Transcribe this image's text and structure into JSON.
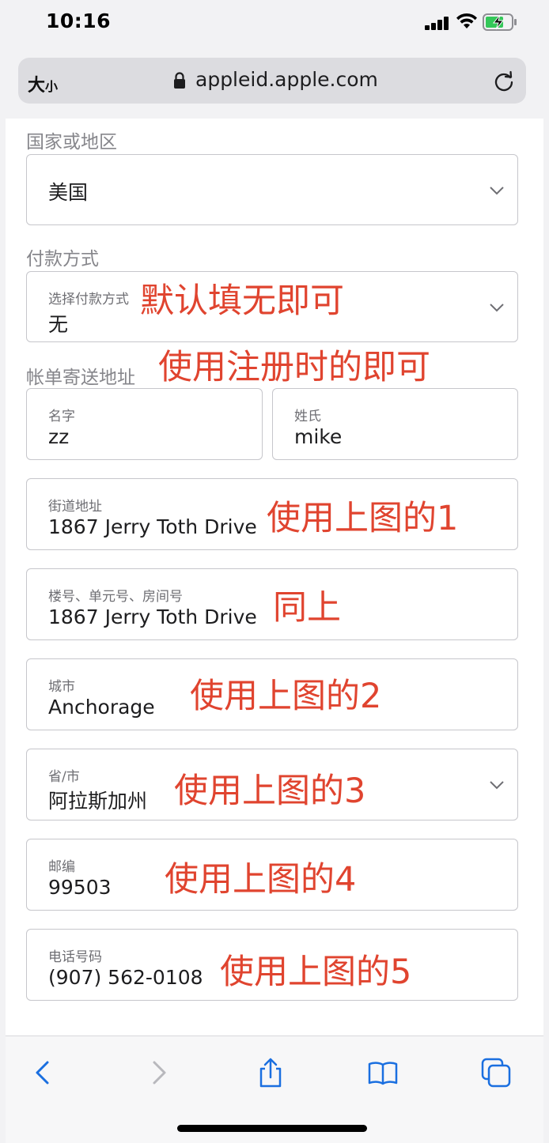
{
  "status": {
    "time": "10:16"
  },
  "browser": {
    "text_size_label": "大",
    "text_size_small": "小",
    "url": "appleid.apple.com"
  },
  "sections": {
    "country": "国家或地区",
    "payment": "付款方式",
    "billing": "帐单寄送地址"
  },
  "fields": {
    "country": {
      "value": "美国"
    },
    "payment": {
      "label": "选择付款方式",
      "value": "无"
    },
    "first_name": {
      "label": "名字",
      "value": "zz"
    },
    "last_name": {
      "label": "姓氏",
      "value": "mike"
    },
    "street": {
      "label": "街道地址",
      "value": "1867  Jerry Toth Drive"
    },
    "building": {
      "label": "楼号、单元号、房间号",
      "value": "1867  Jerry Toth Drive"
    },
    "city": {
      "label": "城市",
      "value": "Anchorage"
    },
    "state": {
      "label": "省/市",
      "value": "阿拉斯加州"
    },
    "zip": {
      "label": "邮编",
      "value": "99503"
    },
    "phone": {
      "label": "电话号码",
      "value": "(907) 562-0108"
    }
  },
  "annotations": {
    "payment": "默认填无即可",
    "billing": "使用注册时的即可",
    "street": "使用上图的1",
    "building": "同上",
    "city": "使用上图的2",
    "state": "使用上图的3",
    "zip": "使用上图的4",
    "phone": "使用上图的5"
  },
  "colors": {
    "annotation": "#e0442f",
    "link_blue": "#1a6fe0",
    "field_border": "#c6c6cb"
  },
  "toolbar": {
    "icons": [
      "back-icon",
      "forward-icon",
      "share-icon",
      "bookmarks-icon",
      "tabs-icon"
    ]
  }
}
